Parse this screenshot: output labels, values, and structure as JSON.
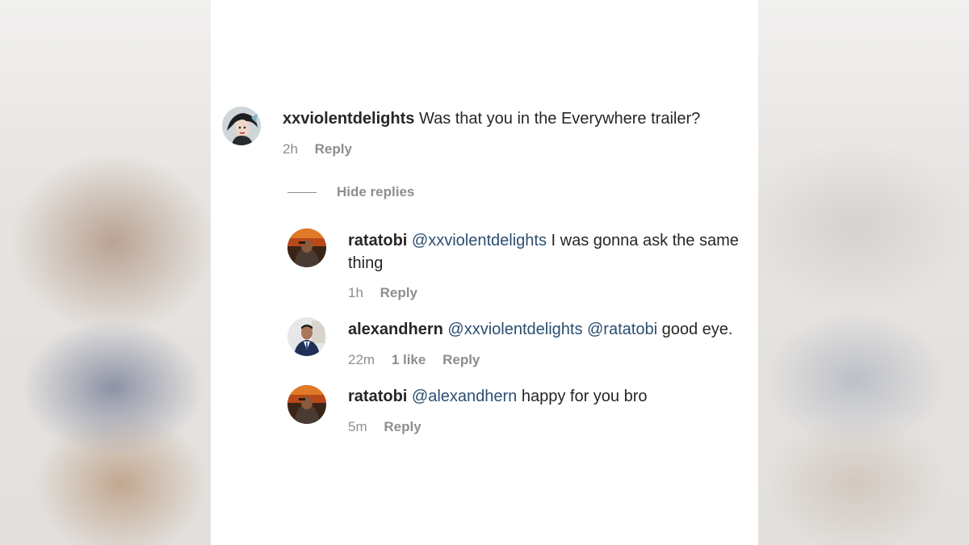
{
  "comments": [
    {
      "username": "xxviolentdelights",
      "text": "Was that you in the Everywhere trailer?",
      "time": "2h",
      "reply_label": "Reply"
    }
  ],
  "hide_replies_label": "Hide replies",
  "replies": [
    {
      "username": "ratatobi",
      "mention": "@xxviolentdelights",
      "text": "I was gonna ask the same thing",
      "time": "1h",
      "reply_label": "Reply"
    },
    {
      "username": "alexandhern",
      "mention": "@xxviolentdelights @ratatobi",
      "text": "good eye.",
      "time": "22m",
      "likes": "1 like",
      "reply_label": "Reply"
    },
    {
      "username": "ratatobi",
      "mention": "@alexandhern",
      "text": "happy for you bro",
      "time": "5m",
      "reply_label": "Reply"
    }
  ],
  "colors": {
    "text": "#262626",
    "muted": "#8e8e8e",
    "mention": "#2b4e70",
    "background": "#ffffff"
  }
}
